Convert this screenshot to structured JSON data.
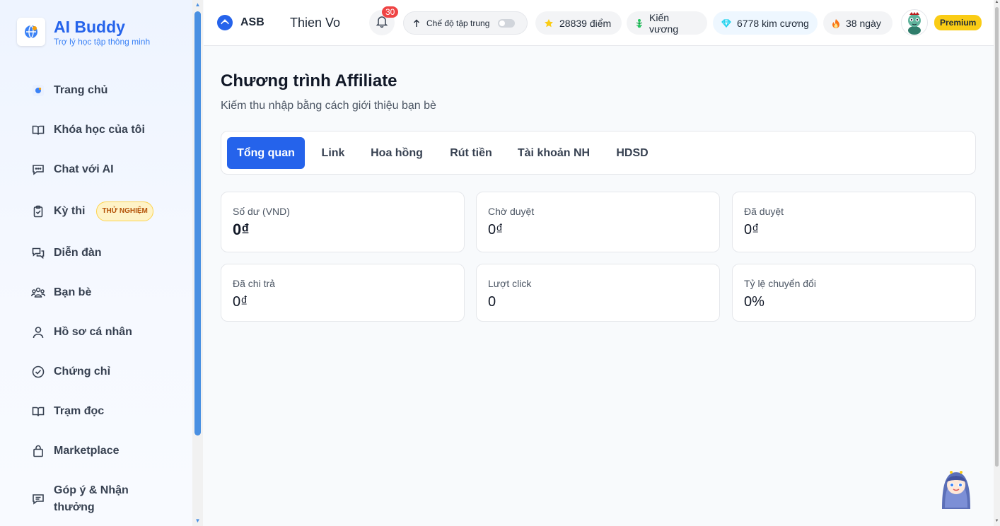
{
  "brand": {
    "name": "AI Buddy",
    "tagline": "Trợ lý học tập thông minh"
  },
  "sidebar": {
    "items": [
      {
        "label": "Trang chủ",
        "icon": "globe-logo-icon"
      },
      {
        "label": "Khóa học của tôi",
        "icon": "book-icon"
      },
      {
        "label": "Chat với AI",
        "icon": "chat-icon"
      },
      {
        "label": "Kỳ thi",
        "icon": "clipboard-check-icon",
        "badge": "THỬ NGHIỆM"
      },
      {
        "label": "Diễn đàn",
        "icon": "forum-icon"
      },
      {
        "label": "Bạn bè",
        "icon": "users-icon"
      },
      {
        "label": "Hồ sơ cá nhân",
        "icon": "user-icon"
      },
      {
        "label": "Chứng chỉ",
        "icon": "check-circle-icon"
      },
      {
        "label": "Trạm đọc",
        "icon": "book-icon"
      },
      {
        "label": "Marketplace",
        "icon": "bag-icon"
      },
      {
        "label": "Góp ý & Nhận thưởng",
        "icon": "feedback-icon"
      }
    ]
  },
  "header": {
    "org": "ASB",
    "user": "Thien Vo",
    "notifications": "30",
    "focus_mode": "Chế độ tập trung",
    "points": "28839 điểm",
    "rank": "Kiến vương",
    "diamonds": "6778 kim cương",
    "streak": "38 ngày",
    "plan": "Premium"
  },
  "page": {
    "title": "Chương trình Affiliate",
    "subtitle": "Kiếm thu nhập bằng cách giới thiệu bạn bè"
  },
  "tabs": [
    {
      "label": "Tổng quan",
      "active": true
    },
    {
      "label": "Link"
    },
    {
      "label": "Hoa hồng"
    },
    {
      "label": "Rút tiền"
    },
    {
      "label": "Tài khoản NH"
    },
    {
      "label": "HDSD"
    }
  ],
  "stats": [
    {
      "label": "Số dư (VND)",
      "value": "0₫"
    },
    {
      "label": "Chờ duyệt",
      "value": "0₫"
    },
    {
      "label": "Đã duyệt",
      "value": "0₫"
    },
    {
      "label": "Đã chi trả",
      "value": "0₫"
    },
    {
      "label": "Lượt click",
      "value": "0"
    },
    {
      "label": "Tỷ lệ chuyển đổi",
      "value": "0%"
    }
  ],
  "colors": {
    "accent": "#2563eb",
    "premium": "#facc15",
    "badge": "#ef4444"
  }
}
